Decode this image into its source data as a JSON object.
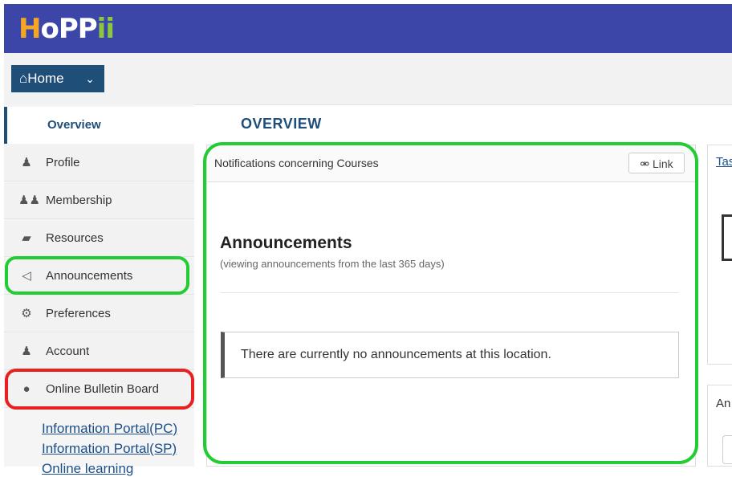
{
  "app": {
    "logo_letters": [
      {
        "ch": "H",
        "color": "#f5a623"
      },
      {
        "ch": "o",
        "color": "#ffffff"
      },
      {
        "ch": "P",
        "color": "#ffffff"
      },
      {
        "ch": "P",
        "color": "#ffffff"
      },
      {
        "ch": "ii",
        "color": "#8dc63f"
      }
    ],
    "header_color": "#3b46a8",
    "accent_color": "#1f4e79"
  },
  "nav": {
    "home_label": "Home",
    "home_icon": "home-icon",
    "chevron_icon": "chevron-down-icon"
  },
  "sidebar": {
    "active_item": "Overview",
    "items": [
      {
        "label": "Profile",
        "icon": "user-icon",
        "glyph": "♟"
      },
      {
        "label": "Membership",
        "icon": "users-icon",
        "glyph": "☷"
      },
      {
        "label": "Resources",
        "icon": "folder-open-icon",
        "glyph": "▰"
      },
      {
        "label": "Announcements",
        "icon": "megaphone-icon",
        "glyph": "◁"
      },
      {
        "label": "Preferences",
        "icon": "gear-icon",
        "glyph": "⚙"
      },
      {
        "label": "Account",
        "icon": "user-icon",
        "glyph": "♟"
      },
      {
        "label": "Online Bulletin Board",
        "icon": "comments-icon",
        "glyph": "●"
      }
    ],
    "links": [
      "Information Portal(PC)",
      "Information Portal(SP)",
      "Online learning"
    ]
  },
  "main": {
    "title": "OVERVIEW",
    "panel": {
      "header": "Notifications concerning Courses",
      "link_label": "Link",
      "link_icon": "link-icon",
      "announcements_title": "Announcements",
      "announcements_sub": "(viewing announcements from the last 365 days)",
      "empty_message": "There are currently no announcements at this location."
    }
  },
  "right": {
    "tab_label": "Tas",
    "panel2_label": "An"
  },
  "highlights": {
    "green": "#22cc33",
    "red": "#e82020"
  }
}
